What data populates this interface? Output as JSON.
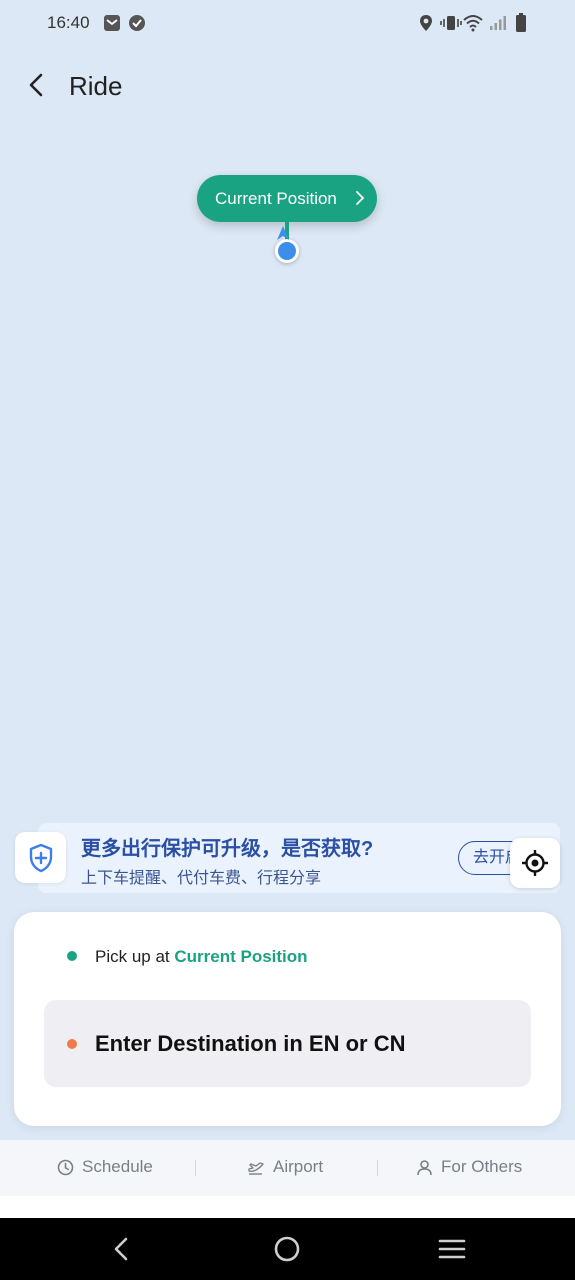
{
  "status_bar": {
    "time": "16:40",
    "icons": [
      "mail-icon",
      "check-circle-icon",
      "location-icon",
      "vibrate-icon",
      "wifi-icon",
      "signal-icon",
      "battery-icon"
    ]
  },
  "header": {
    "title": "Ride"
  },
  "map": {
    "current_position_label": "Current Position"
  },
  "promo": {
    "title": "更多出行保护可升级，是否获取?",
    "subtitle": "上下车提醒、代付车费、行程分享",
    "button_label": "去开启"
  },
  "booking": {
    "pickup_prefix": "Pick up at ",
    "pickup_location": "Current Position",
    "destination_placeholder": "Enter Destination in EN or CN"
  },
  "services": [
    {
      "label": "Schedule",
      "icon": "clock-icon"
    },
    {
      "label": "Airport",
      "icon": "plane-icon"
    },
    {
      "label": "For Others",
      "icon": "person-icon"
    }
  ],
  "colors": {
    "accent": "#1aa383",
    "map_background": "#dce8f5",
    "destination_dot": "#f07b4a",
    "promo_text": "#2a4fa3"
  }
}
